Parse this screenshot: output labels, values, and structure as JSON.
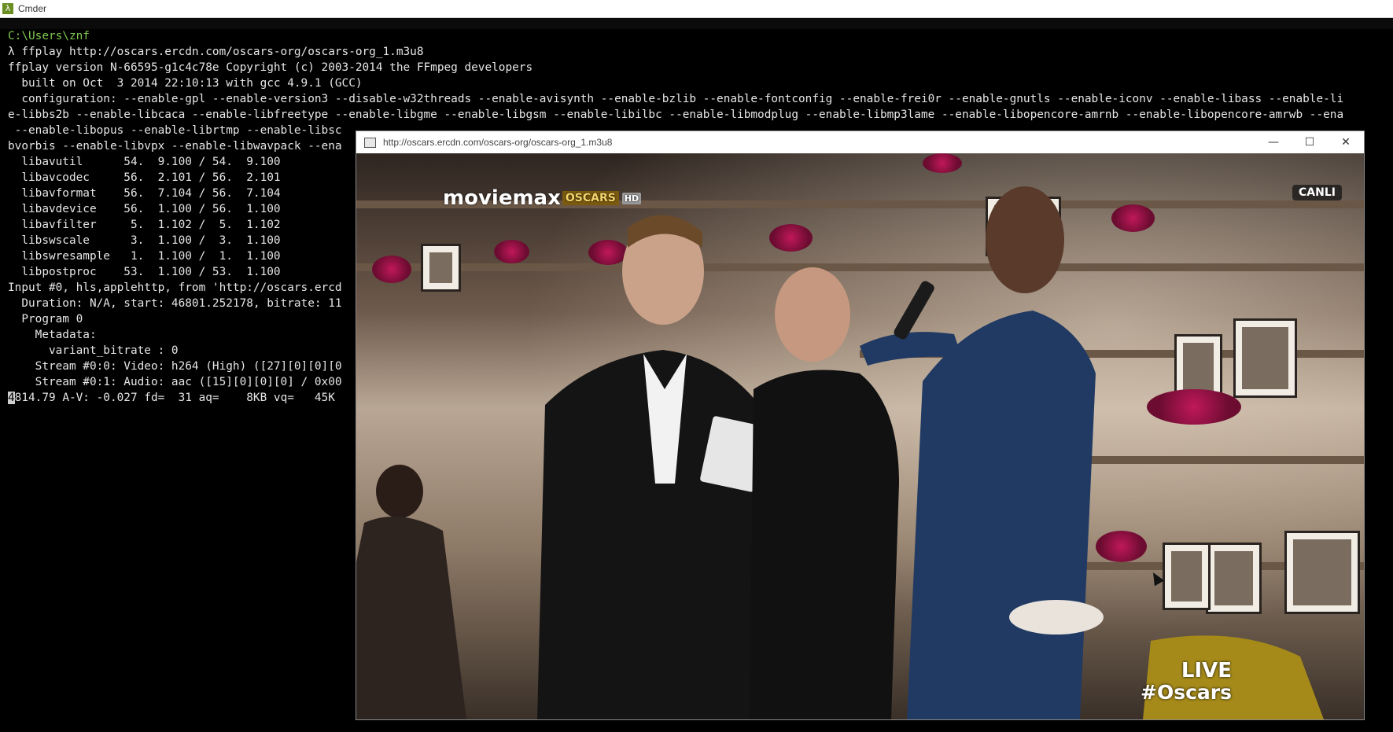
{
  "cmder": {
    "title": "Cmder",
    "icon": "lambda-icon",
    "console_lines": [
      "C:\\Users\\znf",
      "λ ffplay http://oscars.ercdn.com/oscars-org/oscars-org_1.m3u8",
      "ffplay version N-66595-g1c4c78e Copyright (c) 2003-2014 the FFmpeg developers",
      "  built on Oct  3 2014 22:10:13 with gcc 4.9.1 (GCC)",
      "  configuration: --enable-gpl --enable-version3 --disable-w32threads --enable-avisynth --enable-bzlib --enable-fontconfig --enable-frei0r --enable-gnutls --enable-iconv --enable-libass --enable-li",
      "e-libbs2b --enable-libcaca --enable-libfreetype --enable-libgme --enable-libgsm --enable-libilbc --enable-libmodplug --enable-libmp3lame --enable-libopencore-amrnb --enable-libopencore-amrwb --ena",
      " --enable-libopus --enable-librtmp --enable-libsc",
      "bvorbis --enable-libvpx --enable-libwavpack --ena",
      "  libavutil      54.  9.100 / 54.  9.100",
      "  libavcodec     56.  2.101 / 56.  2.101",
      "  libavformat    56.  7.104 / 56.  7.104",
      "  libavdevice    56.  1.100 / 56.  1.100",
      "  libavfilter     5.  1.102 /  5.  1.102",
      "  libswscale      3.  1.100 /  3.  1.100",
      "  libswresample   1.  1.100 /  1.  1.100",
      "  libpostproc    53.  1.100 / 53.  1.100",
      "Input #0, hls,applehttp, from 'http://oscars.ercd",
      "  Duration: N/A, start: 46801.252178, bitrate: 11",
      "  Program 0",
      "    Metadata:",
      "      variant_bitrate : 0",
      "    Stream #0:0: Video: h264 (High) ([27][0][0][0",
      "    Stream #0:1: Audio: aac ([15][0][0][0] / 0x00",
      "6814.79 A-V: -0.027 fd=  31 aq=    8KB vq=   45K"
    ],
    "cursor_char": "4"
  },
  "player": {
    "title": "http://oscars.ercdn.com/oscars-org/oscars-org_1.m3u8",
    "minimize_icon": "minimize-icon",
    "maximize_icon": "maximize-icon",
    "close_icon": "close-icon",
    "overlay": {
      "logo_text": "moviemax",
      "logo_oscars": "OSCARS",
      "logo_hd": "HD",
      "canli": "CANLI",
      "live_line1": "LIVE",
      "live_line2": "#Oscars"
    }
  },
  "colors": {
    "console_bg": "#000000",
    "console_text": "#e6e6e6",
    "path_green": "#7ec94f"
  }
}
